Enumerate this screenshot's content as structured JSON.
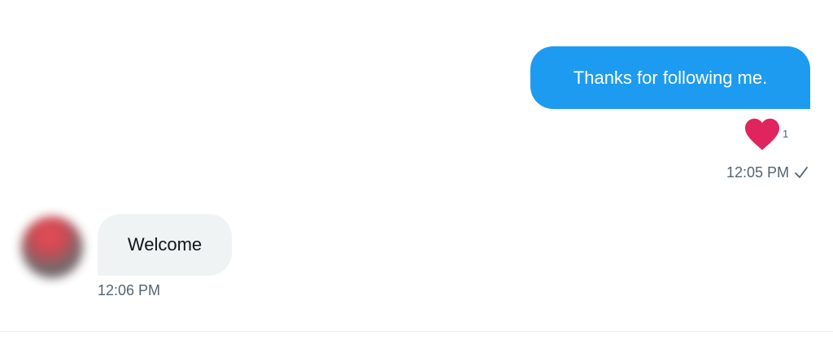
{
  "conversation": {
    "outgoing": {
      "text": "Thanks for following me.",
      "reaction": {
        "icon": "heart-icon",
        "count": "1",
        "color": "#e0245e"
      },
      "time": "12:05 PM",
      "status_icon": "check-icon"
    },
    "incoming": {
      "avatar": "avatar",
      "text": "Welcome",
      "time": "12:06 PM"
    }
  },
  "colors": {
    "accent": "#1d9bf0",
    "incoming_bubble": "#eff3f4",
    "meta_text": "#536471"
  }
}
